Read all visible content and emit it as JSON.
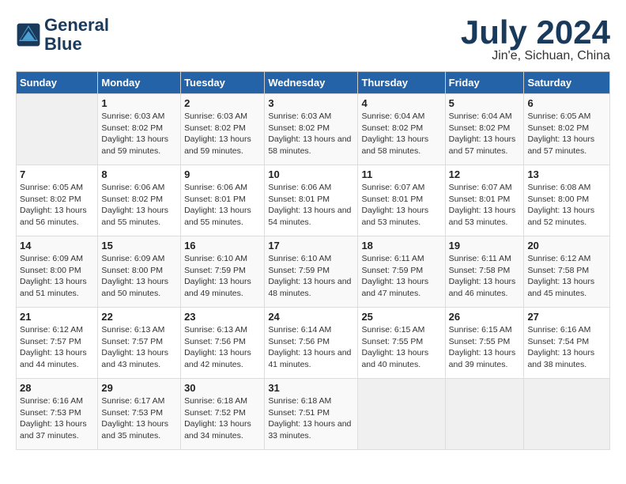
{
  "header": {
    "logo_line1": "General",
    "logo_line2": "Blue",
    "month": "July 2024",
    "location": "Jin'e, Sichuan, China"
  },
  "weekdays": [
    "Sunday",
    "Monday",
    "Tuesday",
    "Wednesday",
    "Thursday",
    "Friday",
    "Saturday"
  ],
  "weeks": [
    [
      {
        "day": "",
        "empty": true
      },
      {
        "day": "1",
        "sunrise": "6:03 AM",
        "sunset": "8:02 PM",
        "daylight": "13 hours and 59 minutes."
      },
      {
        "day": "2",
        "sunrise": "6:03 AM",
        "sunset": "8:02 PM",
        "daylight": "13 hours and 59 minutes."
      },
      {
        "day": "3",
        "sunrise": "6:03 AM",
        "sunset": "8:02 PM",
        "daylight": "13 hours and 58 minutes."
      },
      {
        "day": "4",
        "sunrise": "6:04 AM",
        "sunset": "8:02 PM",
        "daylight": "13 hours and 58 minutes."
      },
      {
        "day": "5",
        "sunrise": "6:04 AM",
        "sunset": "8:02 PM",
        "daylight": "13 hours and 57 minutes."
      },
      {
        "day": "6",
        "sunrise": "6:05 AM",
        "sunset": "8:02 PM",
        "daylight": "13 hours and 57 minutes."
      }
    ],
    [
      {
        "day": "7",
        "sunrise": "6:05 AM",
        "sunset": "8:02 PM",
        "daylight": "13 hours and 56 minutes."
      },
      {
        "day": "8",
        "sunrise": "6:06 AM",
        "sunset": "8:02 PM",
        "daylight": "13 hours and 55 minutes."
      },
      {
        "day": "9",
        "sunrise": "6:06 AM",
        "sunset": "8:01 PM",
        "daylight": "13 hours and 55 minutes."
      },
      {
        "day": "10",
        "sunrise": "6:06 AM",
        "sunset": "8:01 PM",
        "daylight": "13 hours and 54 minutes."
      },
      {
        "day": "11",
        "sunrise": "6:07 AM",
        "sunset": "8:01 PM",
        "daylight": "13 hours and 53 minutes."
      },
      {
        "day": "12",
        "sunrise": "6:07 AM",
        "sunset": "8:01 PM",
        "daylight": "13 hours and 53 minutes."
      },
      {
        "day": "13",
        "sunrise": "6:08 AM",
        "sunset": "8:00 PM",
        "daylight": "13 hours and 52 minutes."
      }
    ],
    [
      {
        "day": "14",
        "sunrise": "6:09 AM",
        "sunset": "8:00 PM",
        "daylight": "13 hours and 51 minutes."
      },
      {
        "day": "15",
        "sunrise": "6:09 AM",
        "sunset": "8:00 PM",
        "daylight": "13 hours and 50 minutes."
      },
      {
        "day": "16",
        "sunrise": "6:10 AM",
        "sunset": "7:59 PM",
        "daylight": "13 hours and 49 minutes."
      },
      {
        "day": "17",
        "sunrise": "6:10 AM",
        "sunset": "7:59 PM",
        "daylight": "13 hours and 48 minutes."
      },
      {
        "day": "18",
        "sunrise": "6:11 AM",
        "sunset": "7:59 PM",
        "daylight": "13 hours and 47 minutes."
      },
      {
        "day": "19",
        "sunrise": "6:11 AM",
        "sunset": "7:58 PM",
        "daylight": "13 hours and 46 minutes."
      },
      {
        "day": "20",
        "sunrise": "6:12 AM",
        "sunset": "7:58 PM",
        "daylight": "13 hours and 45 minutes."
      }
    ],
    [
      {
        "day": "21",
        "sunrise": "6:12 AM",
        "sunset": "7:57 PM",
        "daylight": "13 hours and 44 minutes."
      },
      {
        "day": "22",
        "sunrise": "6:13 AM",
        "sunset": "7:57 PM",
        "daylight": "13 hours and 43 minutes."
      },
      {
        "day": "23",
        "sunrise": "6:13 AM",
        "sunset": "7:56 PM",
        "daylight": "13 hours and 42 minutes."
      },
      {
        "day": "24",
        "sunrise": "6:14 AM",
        "sunset": "7:56 PM",
        "daylight": "13 hours and 41 minutes."
      },
      {
        "day": "25",
        "sunrise": "6:15 AM",
        "sunset": "7:55 PM",
        "daylight": "13 hours and 40 minutes."
      },
      {
        "day": "26",
        "sunrise": "6:15 AM",
        "sunset": "7:55 PM",
        "daylight": "13 hours and 39 minutes."
      },
      {
        "day": "27",
        "sunrise": "6:16 AM",
        "sunset": "7:54 PM",
        "daylight": "13 hours and 38 minutes."
      }
    ],
    [
      {
        "day": "28",
        "sunrise": "6:16 AM",
        "sunset": "7:53 PM",
        "daylight": "13 hours and 37 minutes."
      },
      {
        "day": "29",
        "sunrise": "6:17 AM",
        "sunset": "7:53 PM",
        "daylight": "13 hours and 35 minutes."
      },
      {
        "day": "30",
        "sunrise": "6:18 AM",
        "sunset": "7:52 PM",
        "daylight": "13 hours and 34 minutes."
      },
      {
        "day": "31",
        "sunrise": "6:18 AM",
        "sunset": "7:51 PM",
        "daylight": "13 hours and 33 minutes."
      },
      {
        "day": "",
        "empty": true
      },
      {
        "day": "",
        "empty": true
      },
      {
        "day": "",
        "empty": true
      }
    ]
  ]
}
